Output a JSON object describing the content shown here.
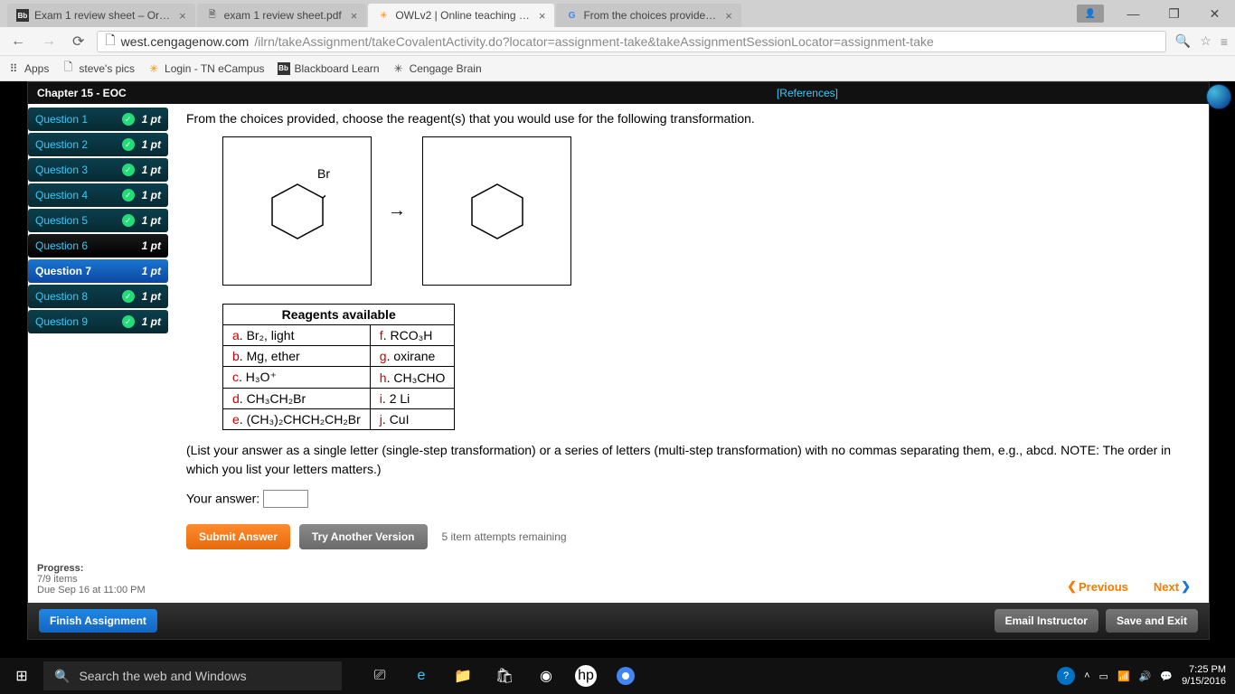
{
  "tabs": [
    {
      "title": "Exam 1 review sheet – Or…",
      "favicon": "Bb"
    },
    {
      "title": "exam 1 review sheet.pdf",
      "favicon": "📄"
    },
    {
      "title": "OWLv2 | Online teaching …",
      "favicon": "✳",
      "active": true
    },
    {
      "title": "From the choices provide…",
      "favicon": "G"
    }
  ],
  "address": {
    "domain": "west.cengagenow.com",
    "path": "/ilrn/takeAssignment/takeCovalentActivity.do?locator=assignment-take&takeAssignmentSessionLocator=assignment-take"
  },
  "bookmarks": {
    "appsLabel": "Apps",
    "items": [
      "steve's pics",
      "Login - TN eCampus",
      "Blackboard Learn",
      "Cengage Brain"
    ]
  },
  "chapter": {
    "title": "Chapter 15 - EOC",
    "references": "[References]"
  },
  "questions": [
    {
      "label": "Question 1",
      "pts": "1 pt",
      "checked": true,
      "style": "teal"
    },
    {
      "label": "Question 2",
      "pts": "1 pt",
      "checked": true,
      "style": "teal"
    },
    {
      "label": "Question 3",
      "pts": "1 pt",
      "checked": true,
      "style": "teal"
    },
    {
      "label": "Question 4",
      "pts": "1 pt",
      "checked": true,
      "style": "teal"
    },
    {
      "label": "Question 5",
      "pts": "1 pt",
      "checked": true,
      "style": "teal"
    },
    {
      "label": "Question 6",
      "pts": "1 pt",
      "checked": false,
      "style": "dark"
    },
    {
      "label": "Question 7",
      "pts": "1 pt",
      "checked": false,
      "style": "blue"
    },
    {
      "label": "Question 8",
      "pts": "1 pt",
      "checked": true,
      "style": "teal"
    },
    {
      "label": "Question 9",
      "pts": "1 pt",
      "checked": true,
      "style": "teal"
    }
  ],
  "question": {
    "stem": "From the choices provided, choose the reagent(s) that you would use for the following transformation.",
    "brLabel": "Br",
    "reagentsHeader": "Reagents available",
    "reagents": [
      {
        "l": "a",
        "left": "Br₂, light",
        "r": "f",
        "right": "RCO₃H"
      },
      {
        "l": "b",
        "left": "Mg, ether",
        "r": "g",
        "right": "oxirane"
      },
      {
        "l": "c",
        "left": "H₃O⁺",
        "r": "h",
        "right": "CH₃CHO"
      },
      {
        "l": "d",
        "left": "CH₃CH₂Br",
        "r": "i",
        "right": "2 Li"
      },
      {
        "l": "e",
        "left": "(CH₃)₂CHCH₂CH₂Br",
        "r": "j",
        "right": "CuI"
      }
    ],
    "note": "(List your answer as a single letter (single-step transformation) or a series of letters (multi-step transformation) with no commas separating them, e.g., abcd. NOTE: The order in which you list your letters matters.)",
    "answerLabel": "Your answer:",
    "answerValue": "",
    "submitLabel": "Submit Answer",
    "tryLabel": "Try Another Version",
    "remaining": "5 item attempts remaining"
  },
  "progress": {
    "title": "Progress:",
    "items": "7/9 items",
    "due": "Due Sep 16 at 11:00 PM"
  },
  "nav": {
    "prev": "Previous",
    "next": "Next"
  },
  "footer": {
    "finish": "Finish Assignment",
    "email": "Email Instructor",
    "save": "Save and Exit"
  },
  "taskbar": {
    "search": "Search the web and Windows",
    "time": "7:25 PM",
    "date": "9/15/2016"
  }
}
